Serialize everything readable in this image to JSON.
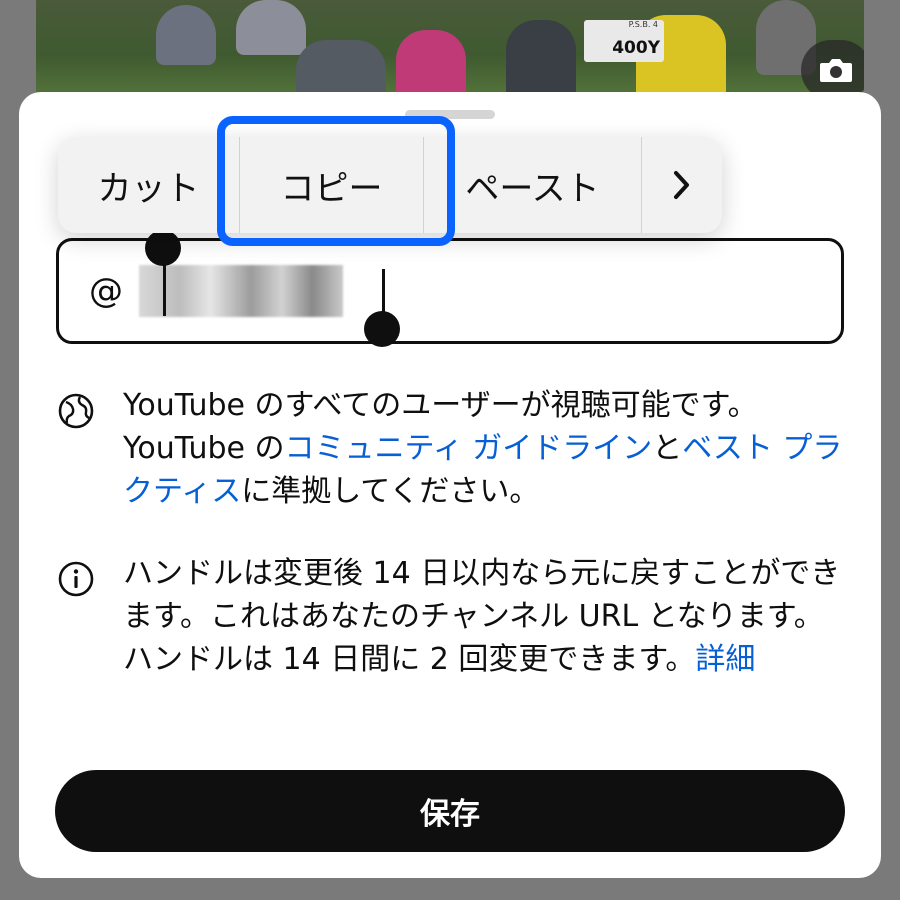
{
  "background": {
    "sign_small_text": "P.S.B. 4",
    "sign_text": "400Y"
  },
  "side_at": "@",
  "handle_field": {
    "prefix": "@",
    "value": "redacted"
  },
  "edit_menu": {
    "cut": "カット",
    "copy": "コピー",
    "paste": "ペースト",
    "more": "›"
  },
  "info_visibility": {
    "text_1": "YouTube のすべてのユーザーが視聴可能です。YouTube の",
    "link_guidelines": "コミュニティ ガイドライン",
    "text_2": "と",
    "link_best_practices": "ベスト プラクティス",
    "text_3": "に準拠してください。"
  },
  "info_handle": {
    "text": "ハンドルは変更後 14 日以内なら元に戻すことができます。これはあなたのチャンネル URL となります。ハンドルは 14 日間に 2 回変更できます。",
    "link_details": "詳細"
  },
  "save_button_label": "保存",
  "colors": {
    "link": "#065fd4",
    "highlight": "#0a62ff",
    "button_bg": "#0f0f0f"
  },
  "icons": {
    "globe": "globe-icon",
    "info": "info-icon",
    "camera": "camera-icon",
    "chevron": "chevron-right-icon"
  }
}
